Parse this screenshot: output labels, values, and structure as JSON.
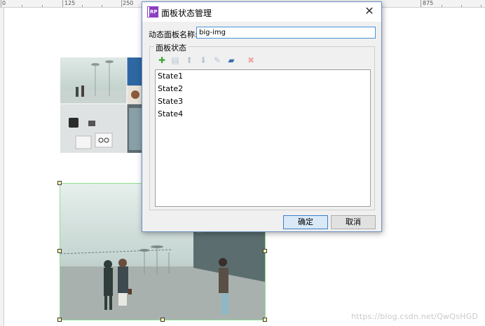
{
  "ruler": {
    "labels": [
      "0",
      "125",
      "250",
      "875"
    ]
  },
  "dialog": {
    "title": "面板状态管理",
    "app_icon_text": "RP",
    "close_glyph": "✕",
    "name_label": "动态面板名称:",
    "name_value": "big-img",
    "group_label": "面板状态",
    "toolbar": {
      "add": "✚",
      "copy": "▤",
      "move_up": "⬆",
      "move_down": "⬇",
      "edit": "✎",
      "edit_all": "▰",
      "delete": "✖"
    },
    "states": [
      "State1",
      "State2",
      "State3",
      "State4"
    ],
    "ok_label": "确定",
    "cancel_label": "取消"
  },
  "watermark": "https://blog.csdn.net/QwQsHGD",
  "colors": {
    "accent": "#3c7fc9",
    "add_green": "#3fa435",
    "delete_red": "#f0a8a8",
    "edit_blue": "#3b6fb0",
    "selection_green": "#8fe08f",
    "handle_yellow": "#fff5a8"
  }
}
